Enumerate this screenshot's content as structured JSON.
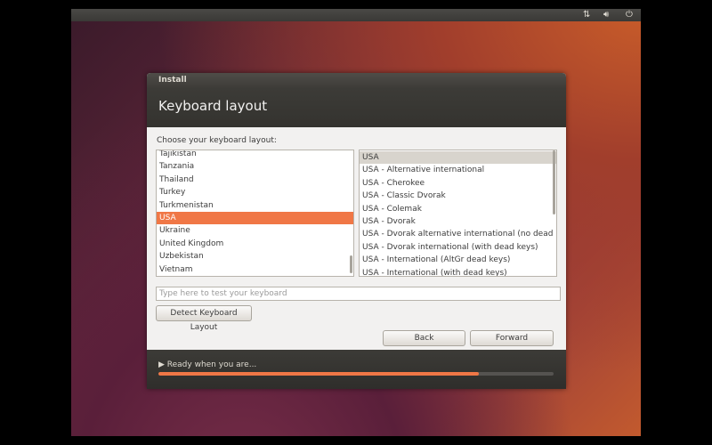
{
  "topbar": {
    "network_icon": "network-arrows-icon",
    "volume_icon": "volume-icon",
    "power_icon": "power-icon"
  },
  "window": {
    "title": "Install",
    "heading": "Keyboard layout",
    "prompt": "Choose your keyboard layout:"
  },
  "layouts": {
    "items": [
      "Tajikistan",
      "Tanzania",
      "Thailand",
      "Turkey",
      "Turkmenistan",
      "USA",
      "Ukraine",
      "United Kingdom",
      "Uzbekistan",
      "Vietnam"
    ],
    "selected": "USA"
  },
  "variants": {
    "items": [
      "USA",
      "USA - Alternative international",
      "USA - Cherokee",
      "USA - Classic Dvorak",
      "USA - Colemak",
      "USA - Dvorak",
      "USA - Dvorak alternative international (no dead keys)",
      "USA - Dvorak international (with dead keys)",
      "USA - International (AltGr dead keys)",
      "USA - International (with dead keys)"
    ],
    "selected": "USA"
  },
  "test_input": {
    "value": "",
    "placeholder": "Type here to test your keyboard"
  },
  "buttons": {
    "detect": "Detect Keyboard Layout",
    "back": "Back",
    "forward": "Forward"
  },
  "footer": {
    "status": "▶ Ready when you are...",
    "progress": 0.81
  },
  "colors": {
    "accent": "#f07746",
    "dark_panel": "#3c3b37"
  }
}
